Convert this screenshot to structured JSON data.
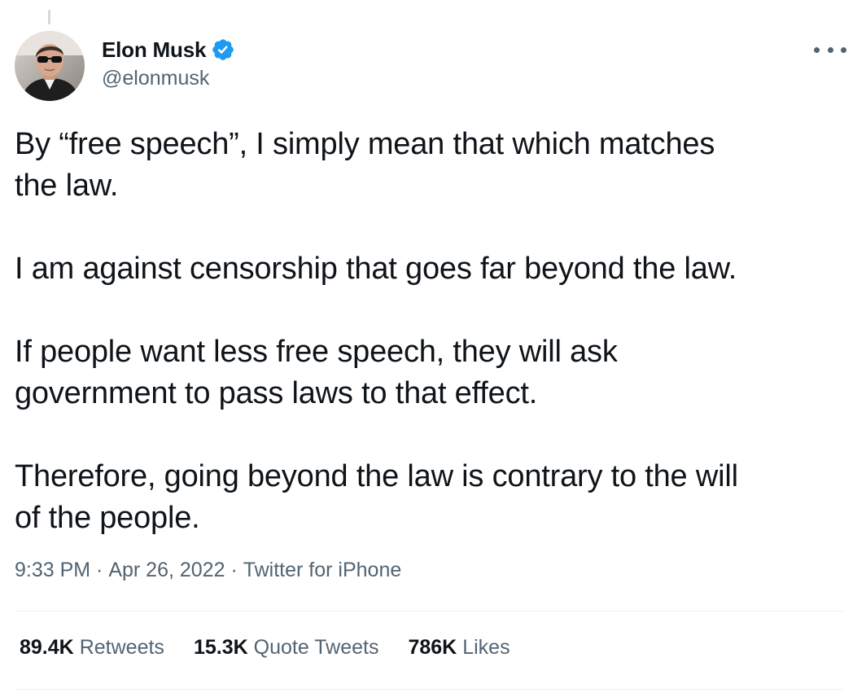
{
  "author": {
    "display_name": "Elon Musk",
    "handle": "@elonmusk",
    "verified": true,
    "verified_color": "#1d9bf0"
  },
  "tweet": {
    "paragraphs": [
      "By “free speech”, I simply mean that which matches\nthe law.",
      "I am against censorship that goes far beyond the law.",
      "If people want less free speech, they will ask\ngovernment to pass laws to that effect.",
      "Therefore, going beyond the law is contrary to the will\nof the people."
    ]
  },
  "meta": {
    "time": "9:33 PM",
    "separator": " · ",
    "date": "Apr 26, 2022",
    "source": "Twitter for iPhone"
  },
  "stats": {
    "retweets_count": "89.4K",
    "retweets_label": "Retweets",
    "quotes_count": "15.3K",
    "quotes_label": "Quote Tweets",
    "likes_count": "786K",
    "likes_label": "Likes"
  },
  "icons": {
    "more": "more-options-icon",
    "verified": "verified-badge-icon"
  }
}
